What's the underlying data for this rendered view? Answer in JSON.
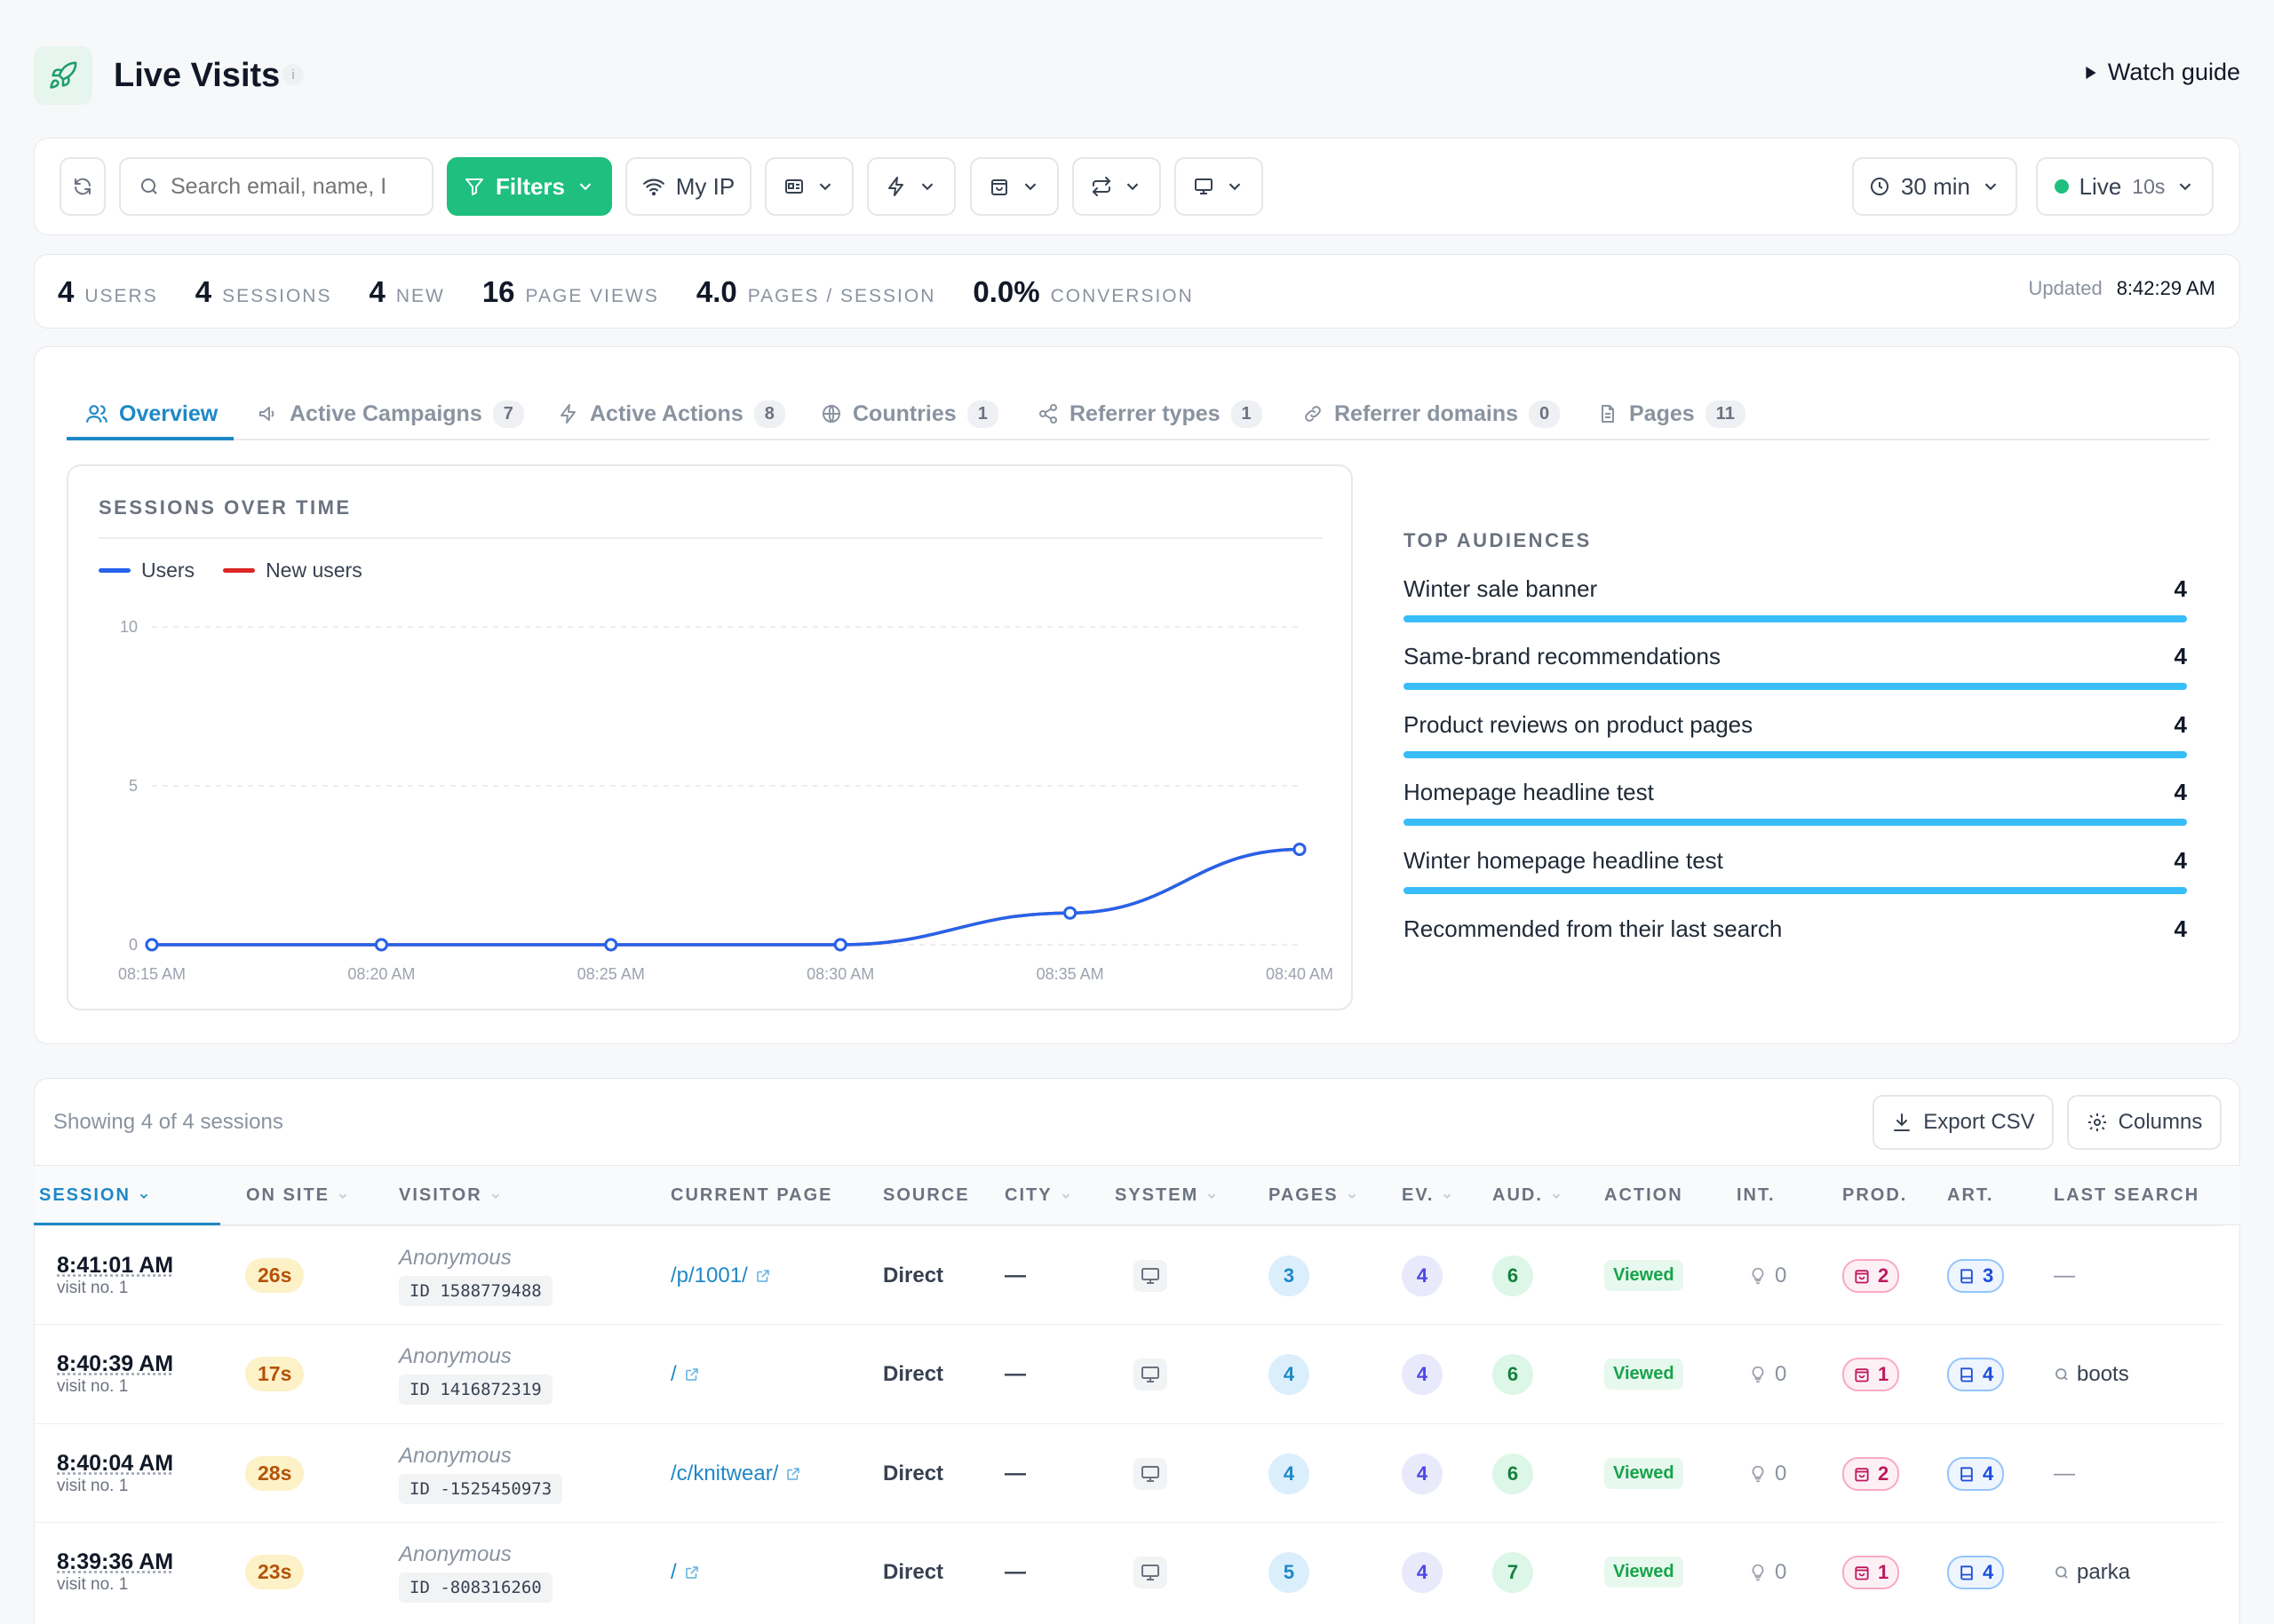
{
  "header": {
    "title": "Live Visits",
    "info": "i",
    "watch_guide": "Watch guide"
  },
  "toolbar": {
    "search_placeholder": "Search email, name, I",
    "filters_label": "Filters",
    "myip_label": "My IP",
    "range_label": "30 min",
    "live_label": "Live",
    "live_interval": "10s"
  },
  "stats": {
    "users_value": "4",
    "users_label": "Users",
    "sessions_value": "4",
    "sessions_label": "Sessions",
    "new_value": "4",
    "new_label": "New",
    "pageviews_value": "16",
    "pageviews_label": "Page views",
    "pps_value": "4.0",
    "pps_label": "Pages / session",
    "conv_value": "0.0%",
    "conv_label": "Conversion",
    "updated_label": "Updated",
    "updated_time": "8:42:29 AM"
  },
  "tabs": [
    {
      "label": "Overview",
      "count": ""
    },
    {
      "label": "Active Campaigns",
      "count": "7"
    },
    {
      "label": "Active Actions",
      "count": "8"
    },
    {
      "label": "Countries",
      "count": "1"
    },
    {
      "label": "Referrer types",
      "count": "1"
    },
    {
      "label": "Referrer domains",
      "count": "0"
    },
    {
      "label": "Pages",
      "count": "11"
    }
  ],
  "chart_data": {
    "type": "line",
    "title": "SESSIONS OVER TIME",
    "x": [
      "08:15 AM",
      "08:20 AM",
      "08:25 AM",
      "08:30 AM",
      "08:35 AM",
      "08:40 AM"
    ],
    "series": [
      {
        "name": "Users",
        "color": "#2563eb",
        "values": [
          0,
          0,
          0,
          0,
          1,
          3
        ]
      },
      {
        "name": "New users",
        "color": "#dc2626",
        "values": [
          0,
          0,
          0,
          0,
          1,
          3
        ]
      }
    ],
    "ylim": [
      0,
      10
    ],
    "yticks": [
      "10",
      "5",
      "0"
    ],
    "grid": true,
    "legend": "top-left"
  },
  "audiences": {
    "title": "TOP AUDIENCES",
    "items": [
      {
        "label": "Winter sale banner",
        "value": "4"
      },
      {
        "label": "Same-brand recommendations",
        "value": "4"
      },
      {
        "label": "Product reviews on product pages",
        "value": "4"
      },
      {
        "label": "Homepage headline test",
        "value": "4"
      },
      {
        "label": "Winter homepage headline test",
        "value": "4"
      },
      {
        "label": "Recommended from their last search",
        "value": "4"
      }
    ]
  },
  "table": {
    "showing": "Showing 4 of 4 sessions",
    "export_label": "Export CSV",
    "columns_label": "Columns",
    "headers": {
      "session": "Session",
      "onsite": "On site",
      "visitor": "Visitor",
      "page": "Current page",
      "source": "Source",
      "city": "City",
      "system": "System",
      "pages": "Pages",
      "ev": "Ev.",
      "aud": "Aud.",
      "action": "Action",
      "int": "Int.",
      "prod": "Prod.",
      "art": "Art.",
      "search": "Last search"
    },
    "rows": [
      {
        "time": "8:41:01 AM",
        "visit": "visit no. 1",
        "onsite": "26s",
        "visitor": "Anonymous",
        "id": "ID 1588779488",
        "page": "/p/1001/",
        "source": "Direct",
        "city": "—",
        "pages": "3",
        "ev": "4",
        "aud": "6",
        "action": "Viewed",
        "int": "0",
        "prod": "2",
        "art": "3",
        "search": "—"
      },
      {
        "time": "8:40:39 AM",
        "visit": "visit no. 1",
        "onsite": "17s",
        "visitor": "Anonymous",
        "id": "ID 1416872319",
        "page": "/",
        "source": "Direct",
        "city": "—",
        "pages": "4",
        "ev": "4",
        "aud": "6",
        "action": "Viewed",
        "int": "0",
        "prod": "1",
        "art": "4",
        "search": "boots"
      },
      {
        "time": "8:40:04 AM",
        "visit": "visit no. 1",
        "onsite": "28s",
        "visitor": "Anonymous",
        "id": "ID -1525450973",
        "page": "/c/knitwear/",
        "source": "Direct",
        "city": "—",
        "pages": "4",
        "ev": "4",
        "aud": "6",
        "action": "Viewed",
        "int": "0",
        "prod": "2",
        "art": "4",
        "search": "—"
      },
      {
        "time": "8:39:36 AM",
        "visit": "visit no. 1",
        "onsite": "23s",
        "visitor": "Anonymous",
        "id": "ID -808316260",
        "page": "/",
        "source": "Direct",
        "city": "—",
        "pages": "5",
        "ev": "4",
        "aud": "7",
        "action": "Viewed",
        "int": "0",
        "prod": "1",
        "art": "4",
        "search": "parka"
      }
    ]
  }
}
